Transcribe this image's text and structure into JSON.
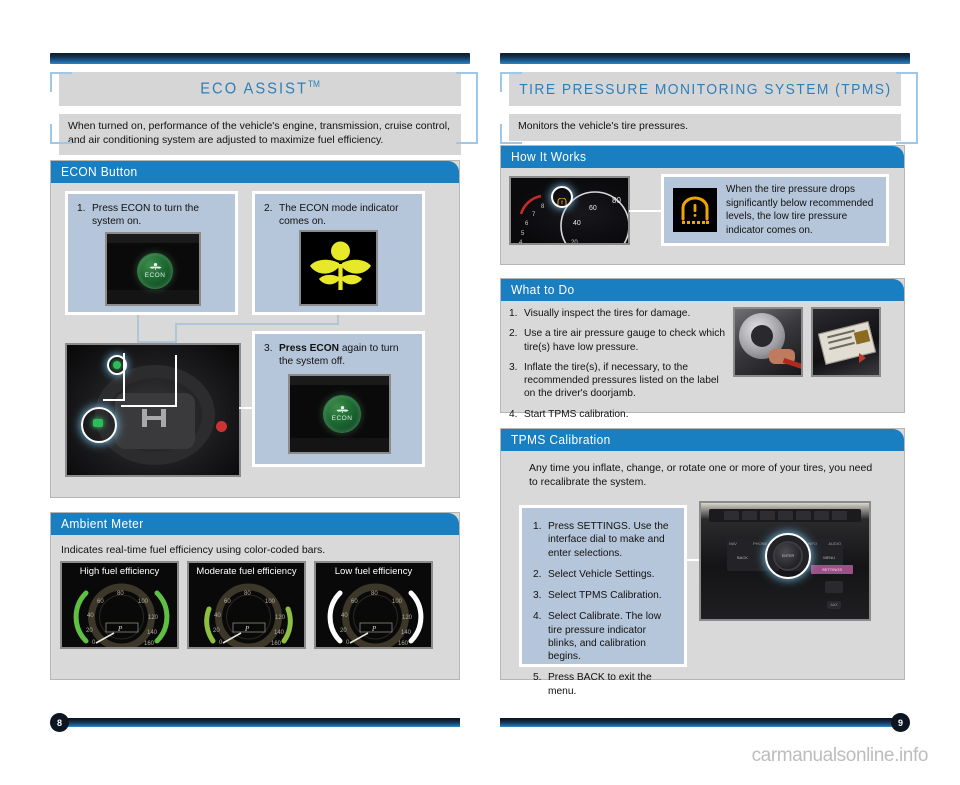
{
  "left_page": {
    "title": "ECO ASSIST",
    "title_tm": "TM",
    "subtitle": "When turned on, performance of the vehicle's engine, transmission, cruise control, and air conditioning system are adjusted to maximize fuel efficiency.",
    "page_number": "8",
    "sections": [
      {
        "heading": "ECON Button",
        "steps": [
          {
            "num": "1.",
            "text": "Press ECON to turn the system on."
          },
          {
            "num": "2.",
            "text": "The ECON mode indicator comes on."
          },
          {
            "num": "3.",
            "bold": "Press ECON",
            "text": " again to turn the system off."
          }
        ],
        "button_label": "ECON",
        "photo_names": [
          "econ-button-photo",
          "econ-indicator-photo",
          "steering-wheel-photo",
          "econ-button-off-photo"
        ]
      },
      {
        "heading": "Ambient Meter",
        "body": "Indicates real-time fuel efficiency using color-coded bars.",
        "gauges": [
          {
            "label": "High fuel efficiency",
            "bar_color": "#5fbf42"
          },
          {
            "label": "Moderate fuel efficiency",
            "bar_color": "#8fbf42"
          },
          {
            "label": "Low fuel efficiency",
            "bar_color": "#ffffff"
          }
        ],
        "gauge_ticks": [
          "0",
          "20",
          "40",
          "60",
          "80",
          "100",
          "120",
          "140",
          "160"
        ],
        "gear_indicator": "P"
      }
    ]
  },
  "right_page": {
    "title": "TIRE PRESSURE MONITORING SYSTEM (TPMS)",
    "subtitle": "Monitors the vehicle's tire pressures.",
    "page_number": "9",
    "sections": [
      {
        "heading": "How It Works",
        "callout": "When the tire pressure drops significantly below recommended levels, the low tire pressure indicator comes on.",
        "icon_name": "low-tire-pressure-icon",
        "photo_name": "instrument-cluster-photo"
      },
      {
        "heading": "What to Do",
        "steps": [
          {
            "num": "1.",
            "text": "Visually inspect the tires for damage."
          },
          {
            "num": "2.",
            "text": "Use a tire air pressure gauge to check which tire(s) have low pressure."
          },
          {
            "num": "3.",
            "text": "Inflate the tire(s), if necessary, to the recommended pressures listed on the label on the driver's doorjamb."
          },
          {
            "num": "4.",
            "text": "Start TPMS calibration."
          }
        ],
        "photo_names": [
          "tire-gauge-photo",
          "doorjamb-label-photo"
        ]
      },
      {
        "heading": "TPMS Calibration",
        "body": "Any time you inflate, change, or rotate one or more of your tires, you need to recalibrate the system.",
        "steps": [
          {
            "num": "1.",
            "text": "Press SETTINGS. Use the interface dial to make and enter selections."
          },
          {
            "num": "2.",
            "text": "Select Vehicle Settings."
          },
          {
            "num": "3.",
            "text": "Select TPMS Calibration."
          },
          {
            "num": "4.",
            "text": "Select Calibrate.  The low tire pressure indicator blinks, and calibration begins."
          },
          {
            "num": "5.",
            "text": "Press BACK to exit the menu."
          }
        ],
        "photo_name": "center-console-photo",
        "console_labels": [
          "NAV",
          "PHONE",
          "INFO",
          "AUDIO",
          "BACK",
          "MENU",
          "SETTINGS",
          "ENTER",
          "AUX"
        ]
      }
    ]
  },
  "watermark": "carmanualsonline.info",
  "colors": {
    "accent_blue": "#1a7fc1",
    "title_blue": "#2e7fb8",
    "bracket_blue": "#9fc8e8",
    "panel_gray": "#d9d9d9",
    "callout_blue_gray": "#b6c6da",
    "econ_green": "#1d6a33",
    "tpms_amber": "#f0a400"
  }
}
